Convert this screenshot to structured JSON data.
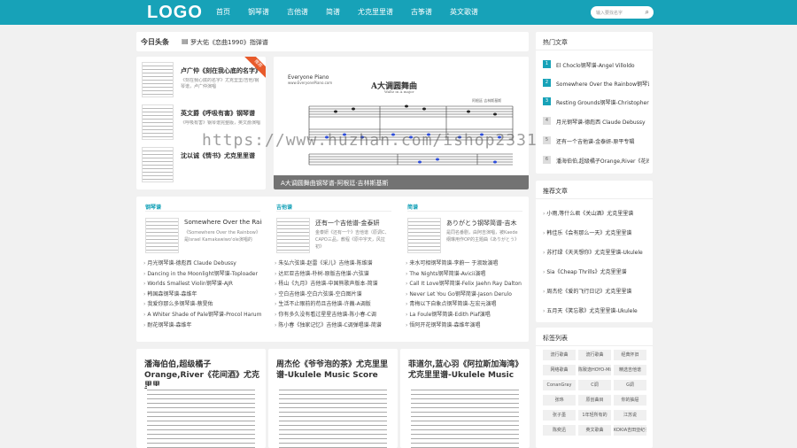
{
  "nav": {
    "logo": "LOGO",
    "items": [
      "首页",
      "钢琴谱",
      "吉他谱",
      "简谱",
      "尤克里里谱",
      "古筝谱",
      "英文歌谱"
    ],
    "search_placeholder": "输入要找名字"
  },
  "headline": {
    "label": "今日头条",
    "text": "罗大佑《恋曲1990》指弹谱"
  },
  "featured_list": [
    {
      "title": "卢广仲《刻在我心底的名字》",
      "desc": "《刻在我心底的名字》尤克里里/吉他/钢琴谱，卢广仲演唱"
    },
    {
      "title": "英文爵《呼吸有害》钢琴谱",
      "desc": "《呼吸有害》钢琴谱完整版，英文爵演唱"
    },
    {
      "title": "沈以诚《情书》尤克里里谱",
      "desc": ""
    }
  ],
  "featured_badge": "推荐",
  "slider": {
    "brand": "Everyone Piano",
    "brand_url": "www.EveryonePiano.com",
    "score_title": "A大调圆舞曲",
    "score_subtitle": "Waltz in A major",
    "composer": "阿根廷 吉林斯基斯",
    "caption": "A大调圆舞曲钢琴谱-阿根廷·吉林斯基斯"
  },
  "sections": [
    {
      "heading": "钢琴谱",
      "top_title": "Somewhere Over the Rainbow",
      "top_desc": "《Somewhere Over the Rainbow》是Israel Kamakawiwo'ole演唱的",
      "items": [
        "月光钢琴谱-德彪西 Claude Debussy",
        "Dancing in the Moonlight钢琴谱-Toploader",
        "Worlds Smallest Violin钢琴谱-AJR",
        "韩国森钢琴谱-森维年",
        "我爱你那么多钢琴谱-蔡旻佑",
        "A Whiter Shade of Pale钢琴谱-Procol Harum",
        "耐花钢琴谱-森维年"
      ]
    },
    {
      "heading": "吉他谱",
      "top_title": "还有一个吉他谱-金泰妍",
      "top_desc": "金泰妍《还有一个》吉他谱（原调C、CAPO三品，教程《原中字天，风拉初》",
      "items": [
        "朱弘六弦谱-赵雷《采儿》吉他谱-陈维谱",
        "达尼亚吉他谱-朴树-原版吉他谱-六弦谱",
        "杨山《九月》吉他谱-中国熊歌声版本-简谱",
        "空白吉他谱-空白六弦谱-空白图片谱",
        "生活不止眼前的苟且吉他谱-许巍-A调版",
        "你有多久没有看过星星吉他谱-陈小春-C调",
        "陈小春《独家记忆》吉他谱-C调弹唱谱-简谱"
      ]
    },
    {
      "heading": "简谱",
      "top_title": "ありがとう钢琴简谱-吉木",
      "top_desc": "是同名番剧，由阿吉演唱，被Kaede纲琳用作OP的主题曲《ありがとう》",
      "items": [
        "来水可相钢琴简谱-李蔚一 于淑致演唱",
        "The Nights钢琴简谱-Avicii演唱",
        "Call It Love钢琴简谱-Felix Jaehn Ray Dalton",
        "Never Let You Go钢琴简谱-Jason Derulo",
        "青梅以下自象点钢琴简谱-左宏元演唱",
        "La Foule钢琴简谱-Edith Piaf演唱",
        "悟阿开花钢琴简谱-森维年演唱"
      ]
    }
  ],
  "articles": [
    {
      "title": "潘海伯伯,超级橘子Orange,River《花间酒》尤克里里"
    },
    {
      "title": "周杰伦《爷爷泡的茶》尤克里里谱-Ukulele Music Score"
    },
    {
      "title": "菲道尔,蓝心羽《阿拉斯加海湾》尤克里里谱-Ukulele Music"
    }
  ],
  "hot": {
    "heading": "热门文章",
    "items": [
      "El Choclo钢琴谱-Angel Villoldo",
      "Somewhere Over the Rainbow钢琴谱",
      "Resting Grounds钢琴谱-Christopher Larkin",
      "月光钢琴谱-德彪西 Claude Debussy",
      "还有一个吉他谱-金泰妍-原平专辑",
      "潘海伯伯,超级橘子Orange,River《花间酒》"
    ],
    "nums": [
      "1",
      "2",
      "3",
      "4",
      "5",
      "6"
    ]
  },
  "recommend": {
    "heading": "推荐文章",
    "items": [
      "小雨,等什么君《关山酒》尤克里里谱",
      "韩佳乐《会有那么一天》尤克里里谱",
      "苏打绿《天天想你》尤克里里谱-Ukulele",
      "Sia《Cheap Thrills》尤克里里谱",
      "周杰伦《爱的飞行日记》尤克里里谱",
      "五月天《笑忘歌》尤克里里谱-Ukulele"
    ]
  },
  "tags": {
    "heading": "标签列表",
    "items": [
      "流行歌曲",
      "流行歌曲",
      "经典怀旧",
      "网络歌曲",
      "陈致逸HOYO-MiX",
      "精选吉他谱",
      "ConanGray",
      "C调",
      "G调",
      "张玮",
      "原创曲目",
      "你的抽屉",
      "张子墨",
      "1年轻所有的",
      "江苏说",
      "陈奕迅",
      "英文歌曲",
      "KOKIA吉田亚纪子"
    ]
  },
  "watermark": "https://www.huzhan.com/ishop2331"
}
